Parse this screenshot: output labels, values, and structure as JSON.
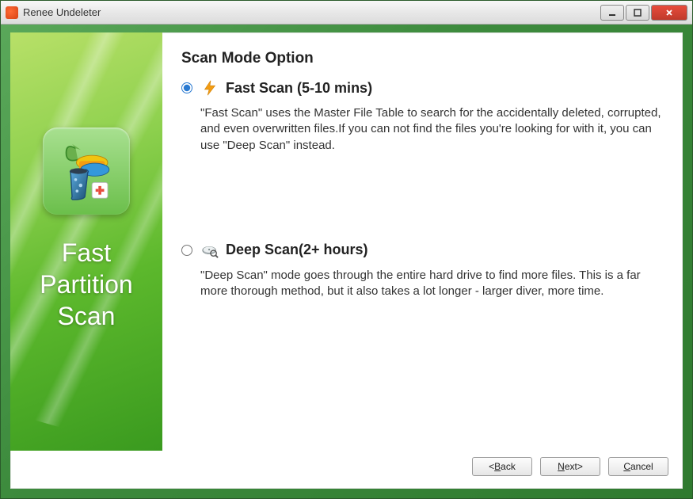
{
  "window": {
    "title": "Renee Undeleter"
  },
  "sidebar": {
    "title_line1": "Fast",
    "title_line2": "Partition",
    "title_line3": "Scan"
  },
  "main": {
    "heading": "Scan Mode Option",
    "options": [
      {
        "selected": true,
        "title": "Fast Scan (5-10 mins)",
        "desc": "\"Fast Scan\" uses the Master File Table to search for the accidentally deleted, corrupted, and even overwritten files.If you can not find the files you're looking for with it, you can use \"Deep Scan\" instead."
      },
      {
        "selected": false,
        "title": "Deep Scan(2+ hours)",
        "desc": "\"Deep Scan\" mode goes through the entire hard drive to find more files. This is a far more thorough method, but it also takes a lot longer - larger diver, more time."
      }
    ]
  },
  "buttons": {
    "back_prefix": "<",
    "back_ul": "B",
    "back_suffix": "ack",
    "next_ul": "N",
    "next_suffix": "ext>",
    "cancel_ul": "C",
    "cancel_suffix": "ancel"
  }
}
